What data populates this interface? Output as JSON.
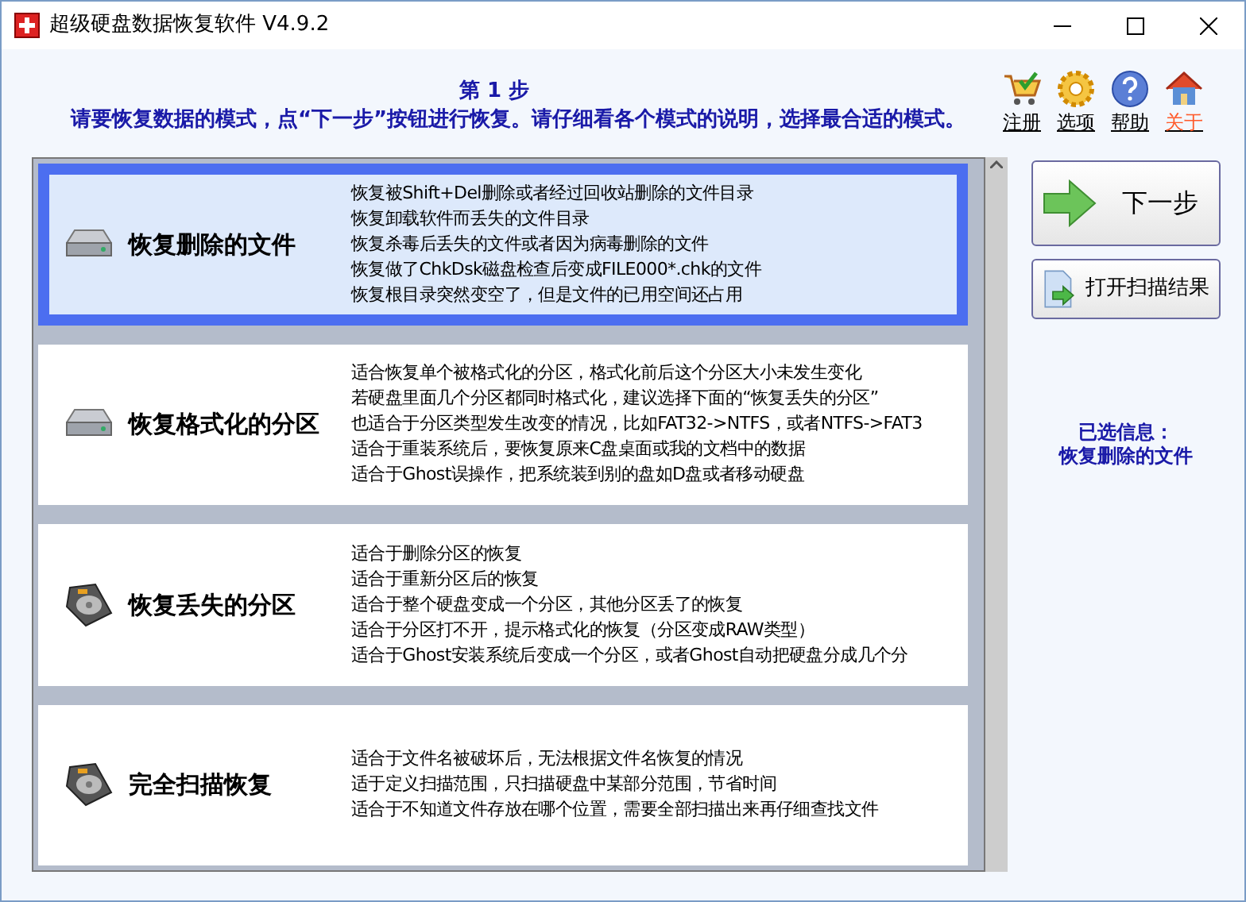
{
  "window": {
    "title": "超级硬盘数据恢复软件 V4.9.2"
  },
  "header": {
    "step": "第 1 步",
    "instruction": "请要恢复数据的模式，点“下一步”按钮进行恢复。请仔细看各个模式的说明，选择最合适的模式。"
  },
  "toolbar": [
    {
      "kind": "cart",
      "label": "注册",
      "color": "#000000"
    },
    {
      "kind": "gear",
      "label": "选项",
      "color": "#000000"
    },
    {
      "kind": "help",
      "label": "帮助",
      "color": "#000000"
    },
    {
      "kind": "home",
      "label": "关于",
      "color": "#ff5a2a"
    }
  ],
  "modes": [
    {
      "kind": "drive",
      "title": "恢复删除的文件",
      "selected": true,
      "lines": [
        "恢复被Shift+Del删除或者经过回收站删除的文件目录",
        "恢复卸载软件而丢失的文件目录",
        "恢复杀毒后丢失的文件或者因为病毒删除的文件",
        "恢复做了ChkDsk磁盘检查后变成FILE000*.chk的文件",
        "恢复根目录突然变空了，但是文件的已用空间还占用"
      ]
    },
    {
      "kind": "drive",
      "title": "恢复格式化的分区",
      "selected": false,
      "lines": [
        "适合恢复单个被格式化的分区，格式化前后这个分区大小未发生变化",
        "若硬盘里面几个分区都同时格式化，建议选择下面的“恢复丢失的分区”",
        "也适合于分区类型发生改变的情况，比如FAT32->NTFS，或者NTFS->FAT3",
        "适合于重装系统后，要恢复原来C盘桌面或我的文档中的数据",
        "适合于Ghost误操作，把系统装到别的盘如D盘或者移动硬盘"
      ]
    },
    {
      "kind": "hdd",
      "title": "恢复丢失的分区",
      "selected": false,
      "lines": [
        "适合于删除分区的恢复",
        "适合于重新分区后的恢复",
        "适合于整个硬盘变成一个分区，其他分区丢了的恢复",
        "适合于分区打不开，提示格式化的恢复（分区变成RAW类型）",
        "适合于Ghost安装系统后变成一个分区，或者Ghost自动把硬盘分成几个分"
      ]
    },
    {
      "kind": "hdd",
      "title": "完全扫描恢复",
      "selected": false,
      "lines": [
        "适合于文件名被破坏后，无法根据文件名恢复的情况",
        "适于定义扫描范围，只扫描硬盘中某部分范围，节省时间",
        "适合于不知道文件存放在哪个位置，需要全部扫描出来再仔细查找文件"
      ]
    }
  ],
  "buttons": [
    {
      "kind": "next",
      "label": "下一步"
    },
    {
      "kind": "open",
      "label": "打开扫描结果"
    }
  ],
  "selected_info": {
    "label": "已选信息：",
    "value": "恢复删除的文件"
  }
}
